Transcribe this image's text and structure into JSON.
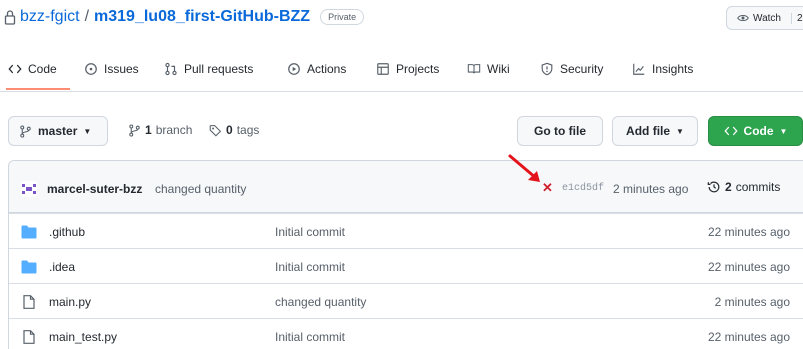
{
  "repo": {
    "owner": "bzz-fgict",
    "separator": "/",
    "name": "m319_lu08_first-GitHub-BZZ",
    "visibility": "Private",
    "watch_label": "Watch",
    "watch_count": "2"
  },
  "nav": {
    "tabs": [
      {
        "label": "Code",
        "icon": "code-icon"
      },
      {
        "label": "Issues",
        "icon": "issue-opened-icon"
      },
      {
        "label": "Pull requests",
        "icon": "git-pull-request-icon"
      },
      {
        "label": "Actions",
        "icon": "play-icon"
      },
      {
        "label": "Projects",
        "icon": "table-icon"
      },
      {
        "label": "Wiki",
        "icon": "book-icon"
      },
      {
        "label": "Security",
        "icon": "shield-icon"
      },
      {
        "label": "Insights",
        "icon": "graph-icon"
      }
    ],
    "active_tab": "Code",
    "active_color": "#fd8c73"
  },
  "branch_bar": {
    "branch_name": "master",
    "branch_count": "1",
    "branch_word": "branch",
    "tag_count": "0",
    "tag_word": "tags",
    "go_to_file": "Go to file",
    "add_file": "Add file",
    "code_button": "Code",
    "code_button_color": "#2da44e"
  },
  "latest_commit": {
    "author": "marcel-suter-bzz",
    "message": "changed quantity",
    "status": "failed",
    "status_color": "#cf222e",
    "sha": "e1cd5df",
    "time": "2 minutes ago",
    "commit_count": "2",
    "commit_word": "commits"
  },
  "files": [
    {
      "type": "directory",
      "name": ".github",
      "message": "Initial commit",
      "time": "22 minutes ago"
    },
    {
      "type": "directory",
      "name": ".idea",
      "message": "Initial commit",
      "time": "22 minutes ago"
    },
    {
      "type": "file",
      "name": "main.py",
      "message": "changed quantity",
      "time": "2 minutes ago"
    },
    {
      "type": "file",
      "name": "main_test.py",
      "message": "Initial commit",
      "time": "22 minutes ago"
    }
  ],
  "annotation": {
    "arrow_color": "#e3141b"
  }
}
